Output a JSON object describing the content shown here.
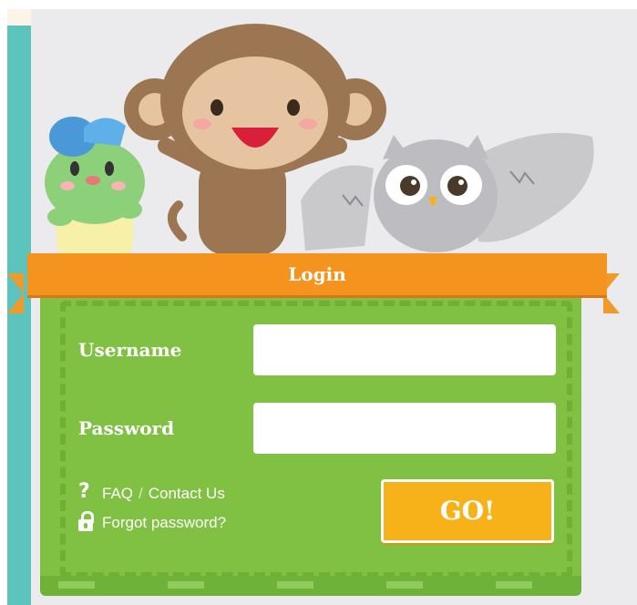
{
  "login": {
    "title": "Login",
    "username_label": "Username",
    "password_label": "Password",
    "username_value": "",
    "password_value": "",
    "faq_link": "FAQ",
    "separator": "/",
    "contact_link": "Contact Us",
    "forgot_link": "Forgot password?",
    "go_button": "GO!"
  },
  "icons": {
    "help": "question-mark-icon",
    "forgot": "lock-icon"
  },
  "colors": {
    "panel_green": "#80c143",
    "ribbon_orange": "#f5931f",
    "button_yellow": "#f7b21a",
    "side_teal": "#5cc3bd",
    "background": "#ebebed"
  }
}
